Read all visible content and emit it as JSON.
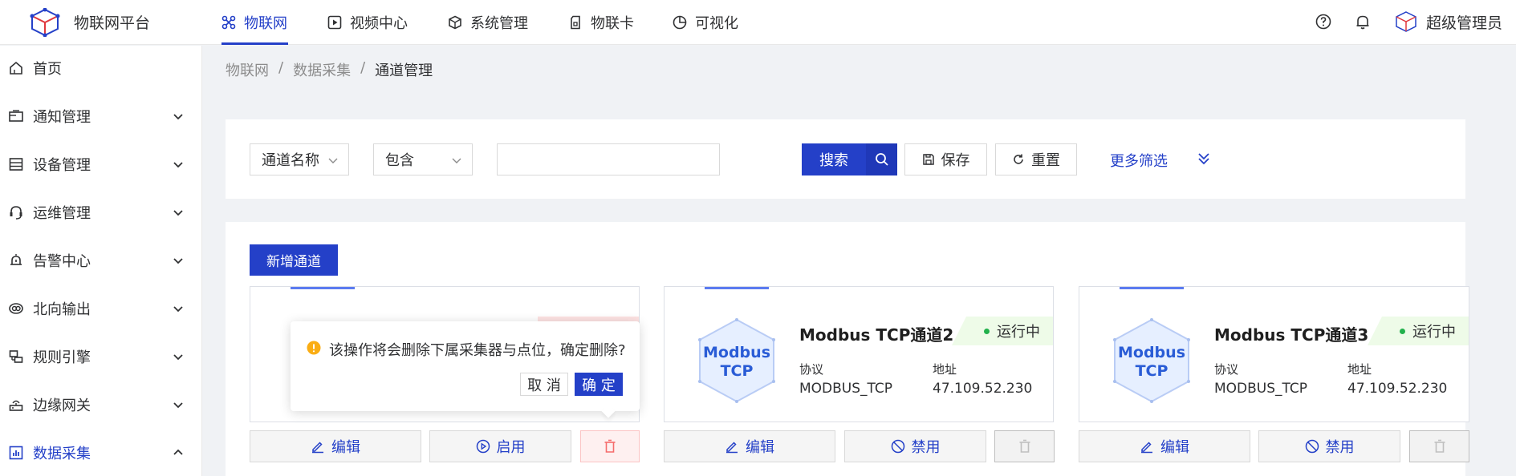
{
  "header": {
    "brand": "物联网平台",
    "nav": [
      {
        "label": "物联网",
        "icon": "iot-icon"
      },
      {
        "label": "视频中心",
        "icon": "video-icon"
      },
      {
        "label": "系统管理",
        "icon": "system-icon"
      },
      {
        "label": "物联卡",
        "icon": "sim-card-icon"
      },
      {
        "label": "可视化",
        "icon": "pie-chart-icon"
      }
    ],
    "user_name": "超级管理员"
  },
  "sidebar": {
    "items": [
      {
        "label": "首页",
        "icon": "home-icon",
        "has_chevron": false
      },
      {
        "label": "通知管理",
        "icon": "notification-icon",
        "has_chevron": true
      },
      {
        "label": "设备管理",
        "icon": "device-icon",
        "has_chevron": true
      },
      {
        "label": "运维管理",
        "icon": "ops-icon",
        "has_chevron": true
      },
      {
        "label": "告警中心",
        "icon": "alarm-icon",
        "has_chevron": true
      },
      {
        "label": "北向输出",
        "icon": "output-icon",
        "has_chevron": true
      },
      {
        "label": "规则引擎",
        "icon": "rule-icon",
        "has_chevron": true
      },
      {
        "label": "边缘网关",
        "icon": "gateway-icon",
        "has_chevron": true
      },
      {
        "label": "数据采集",
        "icon": "data-collect-icon",
        "has_chevron": true,
        "active": true
      }
    ]
  },
  "breadcrumb": [
    "物联网",
    "数据采集",
    "通道管理"
  ],
  "filter": {
    "field_select": "通道名称",
    "op_select": "包含",
    "value": "",
    "search_label": "搜索",
    "save_label": "保存",
    "reset_label": "重置",
    "more_label": "更多筛选"
  },
  "add_button": "新增通道",
  "cards": [
    {
      "title": "Modbus TCP通道2",
      "status": "运行中",
      "protocol_label": "协议",
      "protocol": "MODBUS_TCP",
      "address_label": "地址",
      "address": "47.109.52.230",
      "logo_line1": "Modbus",
      "logo_line2": "TCP",
      "edit_label": "编辑",
      "toggle_label": "禁用"
    },
    {
      "title": "Modbus TCP通道3",
      "status": "运行中",
      "protocol_label": "协议",
      "protocol": "MODBUS_TCP",
      "address_label": "地址",
      "address": "47.109.52.230",
      "logo_line1": "Modbus",
      "logo_line2": "TCP",
      "edit_label": "编辑",
      "toggle_label": "禁用"
    }
  ],
  "first_card": {
    "edit_label": "编辑",
    "toggle_label": "启用"
  },
  "popconfirm": {
    "message": "该操作将会删除下属采集器与点位，确定删除?",
    "cancel_label": "取 消",
    "ok_label": "确 定"
  },
  "colors": {
    "primary": "#2440c8",
    "success": "#22b14c",
    "warning": "#faad14",
    "danger": "#f56c6c"
  }
}
